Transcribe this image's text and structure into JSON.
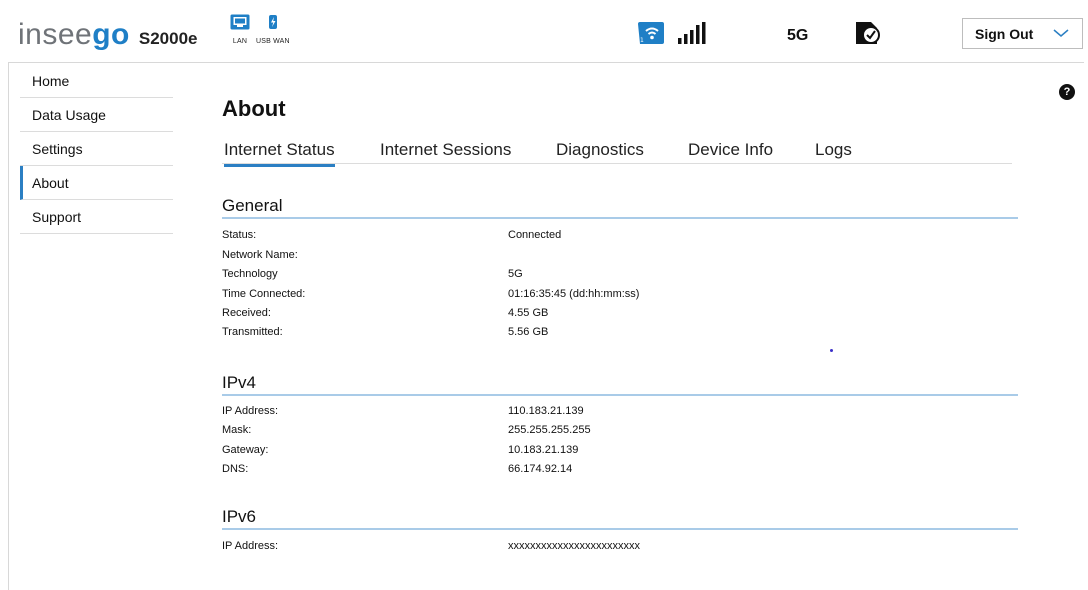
{
  "brand": {
    "logo_prefix": "insee",
    "logo_suffix": "go",
    "model": "S2000e",
    "accent": "#2b7fc3"
  },
  "header": {
    "ports": [
      {
        "icon": "lan-port-icon",
        "label": "LAN"
      },
      {
        "icon": "usb-port-icon",
        "label": "USB WAN"
      }
    ],
    "wifi_icon": "wifi-icon",
    "signal_icon": "signal-bars-icon",
    "network": "5G",
    "sim_icon": "sim-check-icon",
    "signout_label": "Sign Out"
  },
  "sidebar": {
    "items": [
      {
        "label": "Home"
      },
      {
        "label": "Data Usage"
      },
      {
        "label": "Settings"
      },
      {
        "label": "About",
        "active": true
      },
      {
        "label": "Support"
      }
    ]
  },
  "help": {
    "label": "?"
  },
  "page": {
    "title": "About",
    "tabs": [
      {
        "label": "Internet Status",
        "active": true
      },
      {
        "label": "Internet Sessions"
      },
      {
        "label": "Diagnostics"
      },
      {
        "label": "Device Info"
      },
      {
        "label": "Logs"
      }
    ]
  },
  "general": {
    "title": "General",
    "rows": [
      {
        "k": "Status:",
        "v": "Connected"
      },
      {
        "k": "Network Name:",
        "v": ""
      },
      {
        "k": "Technology",
        "v": "5G"
      },
      {
        "k": "Time Connected:",
        "v": "01:16:35:45 (dd:hh:mm:ss)"
      },
      {
        "k": "Received:",
        "v": "4.55 GB"
      },
      {
        "k": "Transmitted:",
        "v": "5.56 GB"
      }
    ]
  },
  "ipv4": {
    "title": "IPv4",
    "rows": [
      {
        "k": "IP Address:",
        "v": "110.183.21.139"
      },
      {
        "k": "Mask:",
        "v": "255.255.255.255"
      },
      {
        "k": "Gateway:",
        "v": "10.183.21.139"
      },
      {
        "k": "DNS:",
        "v": "66.174.92.14"
      }
    ]
  },
  "ipv6": {
    "title": "IPv6",
    "rows": [
      {
        "k": "IP Address:",
        "v": "xxxxxxxxxxxxxxxxxxxxxxxx"
      }
    ]
  }
}
